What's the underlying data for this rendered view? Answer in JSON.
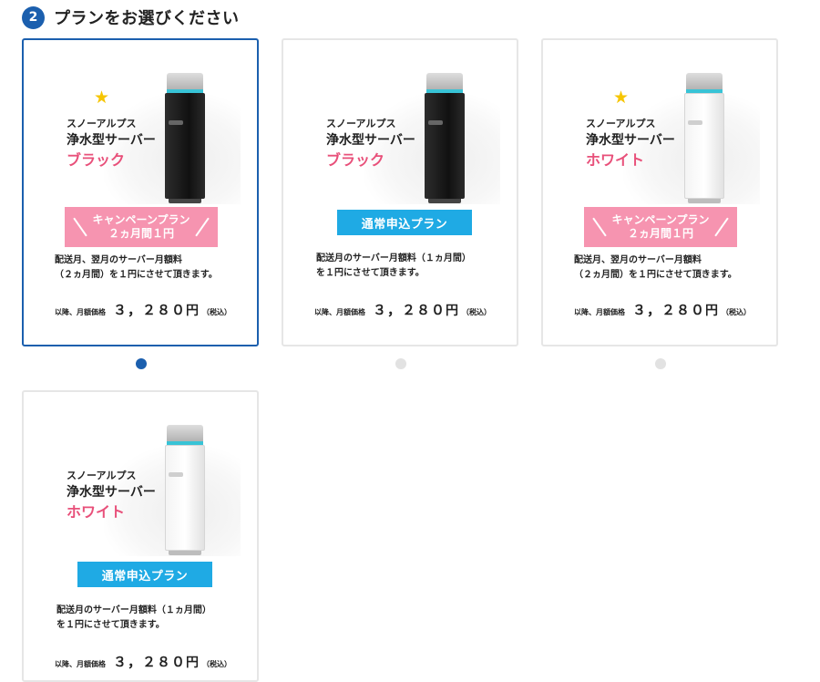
{
  "step": {
    "number": "2",
    "title": "プランをお選びください"
  },
  "common": {
    "brand": "スノーアルプス",
    "model": "浄水型サーバー",
    "star": "★",
    "price_label": "以降、月額価格",
    "price_value": "３，２８０",
    "price_yen": "円",
    "tax": "（税込）"
  },
  "colors": {
    "accent_blue": "#1b5fae",
    "pink": "#f694b0",
    "pink_text": "#e8507a",
    "cyan": "#1faae4",
    "star": "#f6c500"
  },
  "cards": [
    {
      "color_label": "ブラック",
      "selected": true,
      "plan_type": "campaign",
      "banner_line1": "キャンペーンプラン",
      "banner_line2": "２ヵ月間１円",
      "desc_line1": "配送月、翌月のサーバー月額料",
      "desc_line2": "（２ヵ月間）を１円にさせて頂きます。"
    },
    {
      "color_label": "ブラック",
      "selected": false,
      "plan_type": "normal",
      "banner_line1": "通常申込プラン",
      "desc_line1": "配送月のサーバー月額料（１ヵ月間）",
      "desc_line2": "を１円にさせて頂きます。"
    },
    {
      "color_label": "ホワイト",
      "selected": false,
      "plan_type": "campaign",
      "banner_line1": "キャンペーンプラン",
      "banner_line2": "２ヵ月間１円",
      "desc_line1": "配送月、翌月のサーバー月額料",
      "desc_line2": "（２ヵ月間）を１円にさせて頂きます。"
    },
    {
      "color_label": "ホワイト",
      "selected": false,
      "plan_type": "normal",
      "banner_line1": "通常申込プラン",
      "desc_line1": "配送月のサーバー月額料（１ヵ月間）",
      "desc_line2": "を１円にさせて頂きます。"
    }
  ]
}
